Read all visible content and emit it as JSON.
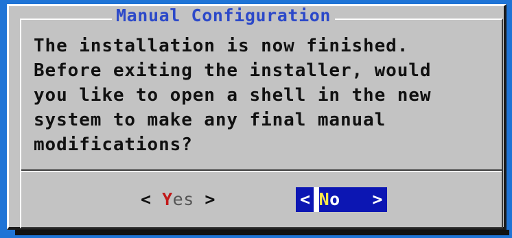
{
  "dialog": {
    "title": "Manual Configuration",
    "message_lines": [
      "The installation is now finished.",
      "Before exiting the installer, would",
      "you like to open a shell in the new",
      "system to make any final manual",
      "modifications?"
    ]
  },
  "buttons": {
    "yes": {
      "open": "< ",
      "hotkey": "Y",
      "rest": "es",
      "close": " >"
    },
    "no": {
      "open": "<",
      "hotkey": "N",
      "rest": "o",
      "close": "   >"
    }
  },
  "colors": {
    "background": "#1f74d6",
    "dialog": "#c3c3c3",
    "title": "#2c49c9",
    "hotkey_inactive": "#c21a1a",
    "selected_button_bg": "#0c16b3",
    "hotkey_active": "#ffe94a"
  }
}
